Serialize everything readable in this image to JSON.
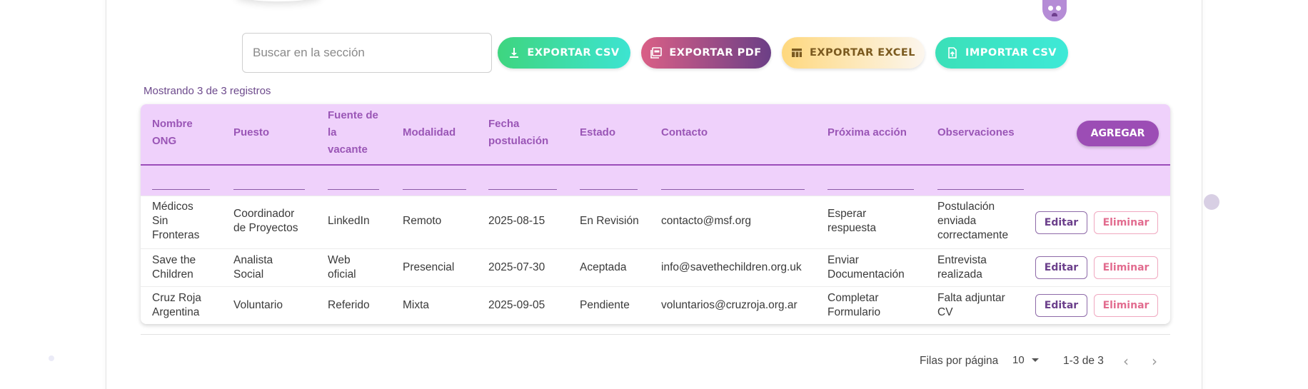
{
  "search": {
    "placeholder": "Buscar en la sección"
  },
  "toolbar": {
    "export_csv": "EXPORTAR CSV",
    "export_pdf": "EXPORTAR PDF",
    "export_excel": "EXPORTAR EXCEL",
    "import_csv": "IMPORTAR CSV"
  },
  "records_count": "Mostrando 3 de 3 registros",
  "table": {
    "headers": {
      "nombre": [
        "Nombre",
        "ONG"
      ],
      "puesto": [
        "Puesto"
      ],
      "fuente": [
        "Fuente de",
        "la",
        "vacante"
      ],
      "modalidad": [
        "Modalidad"
      ],
      "fecha": [
        "Fecha",
        "postulación"
      ],
      "estado": [
        "Estado"
      ],
      "contacto": [
        "Contacto"
      ],
      "proxima": [
        "Próxima acción"
      ],
      "observaciones": [
        "Observaciones"
      ]
    },
    "add_button": "AGREGAR",
    "edit_label": "Editar",
    "delete_label": "Eliminar",
    "rows": [
      {
        "nombre": [
          "Médicos",
          "Sin",
          "Fronteras"
        ],
        "puesto": [
          "Coordinador",
          "de Proyectos"
        ],
        "fuente": [
          "LinkedIn"
        ],
        "modalidad": "Remoto",
        "fecha": "2025-08-15",
        "estado": "En Revisión",
        "contacto": "contacto@msf.org",
        "proxima": [
          "Esperar",
          "respuesta"
        ],
        "observaciones": [
          "Postulación",
          "enviada",
          "correctamente"
        ]
      },
      {
        "nombre": [
          "Save the",
          "Children"
        ],
        "puesto": [
          "Analista",
          "Social"
        ],
        "fuente": [
          "Web",
          "oficial"
        ],
        "modalidad": "Presencial",
        "fecha": "2025-07-30",
        "estado": "Aceptada",
        "contacto": "info@savethechildren.org.uk",
        "proxima": [
          "Enviar",
          "Documentación"
        ],
        "observaciones": [
          "Entrevista",
          "realizada"
        ]
      },
      {
        "nombre": [
          "Cruz Roja",
          "Argentina"
        ],
        "puesto": [
          "Voluntario"
        ],
        "fuente": [
          "Referido"
        ],
        "modalidad": "Mixta",
        "fecha": "2025-09-05",
        "estado": "Pendiente",
        "contacto": "voluntarios@cruzroja.org.ar",
        "proxima": [
          "Completar",
          "Formulario"
        ],
        "observaciones": [
          "Falta adjuntar",
          "CV"
        ]
      }
    ]
  },
  "pagination": {
    "rows_per_page_label": "Filas por página",
    "rows_per_page_value": "10",
    "range": "1-3 de 3"
  },
  "icons": {
    "export_csv": "download-icon",
    "export_pdf": "pdf-icon",
    "export_excel": "table-icon",
    "import_csv": "file-upload-icon",
    "prev": "chevron-left-icon",
    "next": "chevron-right-icon"
  }
}
